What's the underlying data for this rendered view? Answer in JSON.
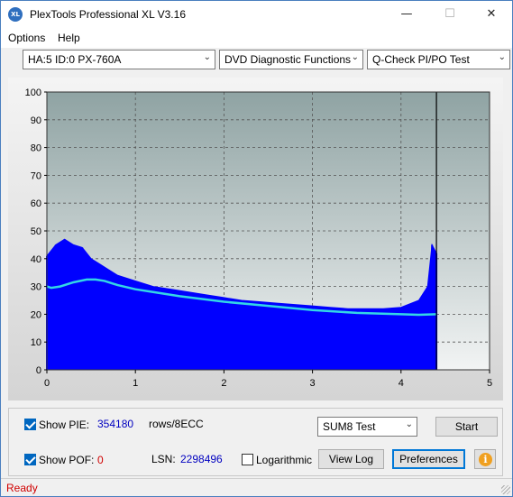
{
  "window": {
    "title": "PlexTools Professional XL V3.16",
    "minimize": "—",
    "maximize": "☐",
    "close": "✕",
    "icon_text": "XL"
  },
  "menu": [
    {
      "label": "Options"
    },
    {
      "label": "Help"
    }
  ],
  "toolbar": {
    "drive": "HA:5 ID:0  PX-760A",
    "function": "DVD Diagnostic Functions",
    "test": "Q-Check PI/PO Test"
  },
  "chart_data": {
    "type": "area",
    "ylim": [
      0,
      100
    ],
    "xlim": [
      0,
      5
    ],
    "y_ticks": [
      "0",
      "10",
      "20",
      "30",
      "40",
      "50",
      "60",
      "70",
      "80",
      "90",
      "100"
    ],
    "x_ticks": [
      "0",
      "1",
      "2",
      "3",
      "4",
      "5"
    ],
    "grid": true,
    "end_marker_x": 4.4,
    "series": [
      {
        "color": "#0000ff",
        "kind": "bars",
        "x": [
          0.0,
          0.1,
          0.2,
          0.3,
          0.4,
          0.5,
          0.6,
          0.7,
          0.8,
          0.9,
          1.0,
          1.2,
          1.4,
          1.6,
          1.8,
          2.0,
          2.2,
          2.4,
          2.6,
          2.8,
          3.0,
          3.2,
          3.4,
          3.6,
          3.8,
          4.0,
          4.2,
          4.3,
          4.35,
          4.4
        ],
        "y": [
          41,
          45,
          47,
          45,
          44,
          40,
          38,
          36,
          34,
          33,
          32,
          30,
          29,
          28,
          27,
          26,
          25,
          24.5,
          24,
          23.5,
          23,
          22.5,
          22,
          22,
          22,
          22.5,
          25,
          30,
          45,
          42
        ]
      },
      {
        "color": "#33d6e6",
        "kind": "line",
        "x": [
          0.0,
          0.05,
          0.15,
          0.3,
          0.45,
          0.55,
          0.65,
          0.8,
          1.0,
          1.2,
          1.5,
          2.0,
          2.5,
          3.0,
          3.5,
          4.0,
          4.2,
          4.4
        ],
        "y": [
          30,
          29.5,
          30,
          31.5,
          32.5,
          32.5,
          32,
          30.5,
          29,
          28,
          26.5,
          24.5,
          23,
          21.5,
          20.5,
          20,
          19.8,
          20
        ]
      }
    ]
  },
  "bottom": {
    "show_pie_label": "Show PIE:",
    "show_pie_value": "354180",
    "pie_units": "rows/8ECC",
    "show_pof_label": "Show POF:",
    "show_pof_value": "0",
    "lsn_label": "LSN:",
    "lsn_value": "2298496",
    "logarithmic_label": "Logarithmic",
    "sum_test": "SUM8 Test",
    "start": "Start",
    "view_log": "View Log",
    "preferences": "Preferences",
    "info_icon_text": "i"
  },
  "status": {
    "text": "Ready"
  }
}
